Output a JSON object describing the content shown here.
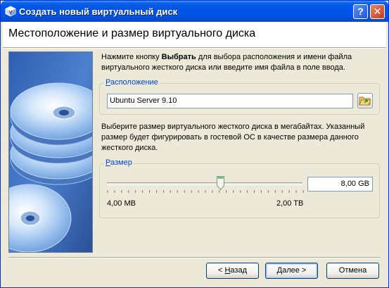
{
  "window": {
    "title": "Создать новый виртуальный диск",
    "help_glyph": "?",
    "close_glyph": "✕"
  },
  "header": {
    "title": "Местоположение и размер виртуального диска"
  },
  "location_description": {
    "part1": "Нажмите кнопку ",
    "bold": "Выбрать",
    "part2": " для выбора расположения и имени файла виртуального жесткого диска или введите имя файла в поле ввода."
  },
  "location_group": {
    "label_mnemonic": "Р",
    "label_rest": "асположение",
    "value": "Ubuntu Server 9.10",
    "browse_icon": "folder-open-icon"
  },
  "size_description": "Выберите размер виртуального жесткого диска в мегабайтах. Указанный размер будет фигурировать в гостевой ОС в качестве размера данного жесткого диска.",
  "size_group": {
    "label_mnemonic": "Р",
    "label_rest": "азмер",
    "value": "8,00 GB",
    "min_label": "4,00 MB",
    "max_label": "2,00 TB",
    "slider_fraction": 0.58
  },
  "buttons": {
    "back_prefix": "< ",
    "back_mnemonic": "Н",
    "back_rest": "азад",
    "next_mnemonic": "Д",
    "next_rest": "алее >",
    "cancel": "Отмена"
  },
  "colors": {
    "titlebar": "#0054e3",
    "group_label": "#0046d5",
    "dialog_bg": "#ece9d8"
  }
}
